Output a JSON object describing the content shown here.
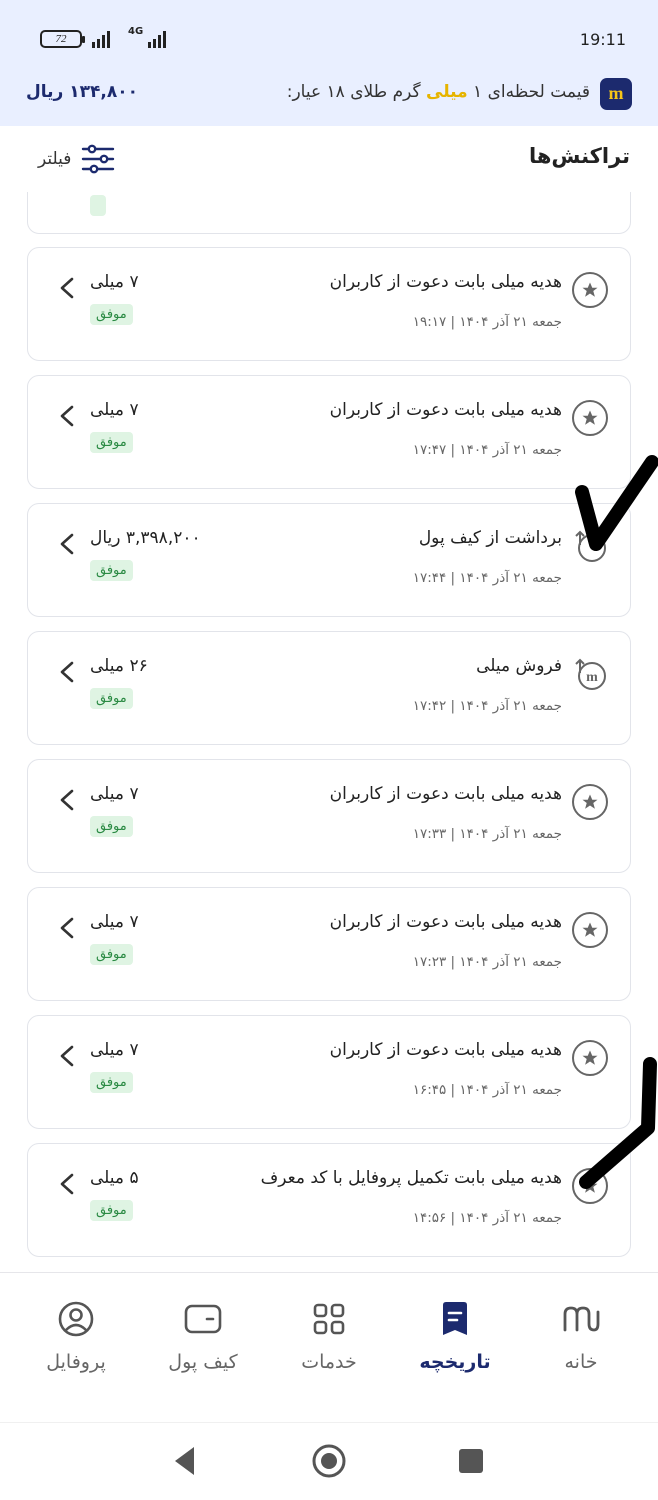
{
  "status_bar": {
    "battery": "72",
    "network": "4G",
    "time": "19:11"
  },
  "price_banner": {
    "brand_letter": "m",
    "label_before": "قیمت لحظه‌ای ۱ ",
    "label_highlight": "میلی",
    "label_after": " گرم طلای ۱۸ عیار:",
    "value": "۱۳۴,۸۰۰ ریال",
    "highlight_color": "#e6b400",
    "brand_color": "#1c2a6e"
  },
  "header": {
    "title": "تراکنش‌ها",
    "filter_label": "فیلتر"
  },
  "transactions": [
    {
      "icon": "star-icon",
      "title": "هدیه میلی بابت دعوت از کاربران",
      "date": "جمعه ۲۱ آذر ۱۴۰۴ | ۱۹:۱۷",
      "amount": "۷ میلی",
      "status": "موفق"
    },
    {
      "icon": "star-icon",
      "title": "هدیه میلی بابت دعوت از کاربران",
      "date": "جمعه ۲۱ آذر ۱۴۰۴ | ۱۷:۴۷",
      "amount": "۷ میلی",
      "status": "موفق"
    },
    {
      "icon": "withdraw-icon",
      "title": "برداشت از کیف پول",
      "date": "جمعه ۲۱ آذر ۱۴۰۴ | ۱۷:۴۴",
      "amount": "۳,۳۹۸,۲۰۰ ریال",
      "status": "موفق"
    },
    {
      "icon": "sell-icon",
      "title": "فروش میلی",
      "date": "جمعه ۲۱ آذر ۱۴۰۴ | ۱۷:۴۲",
      "amount": "۲۶ میلی",
      "status": "موفق"
    },
    {
      "icon": "star-icon",
      "title": "هدیه میلی بابت دعوت از کاربران",
      "date": "جمعه ۲۱ آذر ۱۴۰۴ | ۱۷:۳۳",
      "amount": "۷ میلی",
      "status": "موفق"
    },
    {
      "icon": "star-icon",
      "title": "هدیه میلی بابت دعوت از کاربران",
      "date": "جمعه ۲۱ آذر ۱۴۰۴ | ۱۷:۲۳",
      "amount": "۷ میلی",
      "status": "موفق"
    },
    {
      "icon": "star-icon",
      "title": "هدیه میلی بابت دعوت از کاربران",
      "date": "جمعه ۲۱ آذر ۱۴۰۴ | ۱۶:۴۵",
      "amount": "۷ میلی",
      "status": "موفق"
    },
    {
      "icon": "star-icon",
      "title": "هدیه میلی بابت تکمیل پروفایل با کد معرف",
      "date": "جمعه ۲۱ آذر ۱۴۰۴ | ۱۴:۵۶",
      "amount": "۵ میلی",
      "status": "موفق"
    }
  ],
  "bottom_nav": {
    "items": [
      {
        "label": "خانه",
        "icon": "home-logo-icon",
        "active": false
      },
      {
        "label": "تاریخچه",
        "icon": "history-icon",
        "active": true
      },
      {
        "label": "خدمات",
        "icon": "services-grid-icon",
        "active": false
      },
      {
        "label": "کیف پول",
        "icon": "wallet-icon",
        "active": false
      },
      {
        "label": "پروفایل",
        "icon": "profile-icon",
        "active": false
      }
    ]
  },
  "system_nav": {
    "buttons": [
      "back-icon",
      "home-icon",
      "recents-icon"
    ]
  }
}
